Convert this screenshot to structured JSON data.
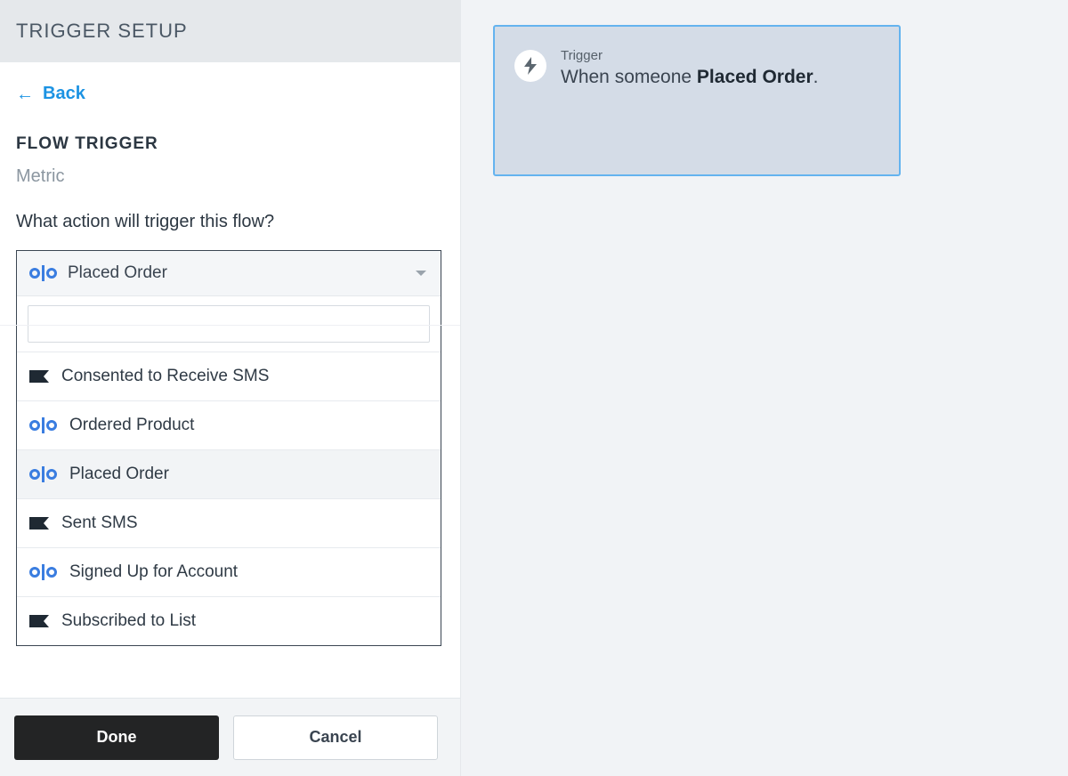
{
  "sidebar": {
    "header_title": "TRIGGER SETUP",
    "back_label": "Back",
    "section_title": "FLOW TRIGGER",
    "metric_label": "Metric",
    "question": "What action will trigger this flow?",
    "selected_option": "Placed Order",
    "search_value": "",
    "options": [
      {
        "icon": "flag",
        "label": "Consented to Receive SMS",
        "selected": false
      },
      {
        "icon": "olo",
        "label": "Ordered Product",
        "selected": false
      },
      {
        "icon": "olo",
        "label": "Placed Order",
        "selected": true
      },
      {
        "icon": "flag",
        "label": "Sent SMS",
        "selected": false
      },
      {
        "icon": "olo",
        "label": "Signed Up for Account",
        "selected": false
      },
      {
        "icon": "flag",
        "label": "Subscribed to List",
        "selected": false
      }
    ]
  },
  "footer": {
    "done_label": "Done",
    "cancel_label": "Cancel"
  },
  "canvas": {
    "trigger_label": "Trigger",
    "trigger_prefix": "When someone ",
    "trigger_event": "Placed Order",
    "trigger_suffix": "."
  }
}
